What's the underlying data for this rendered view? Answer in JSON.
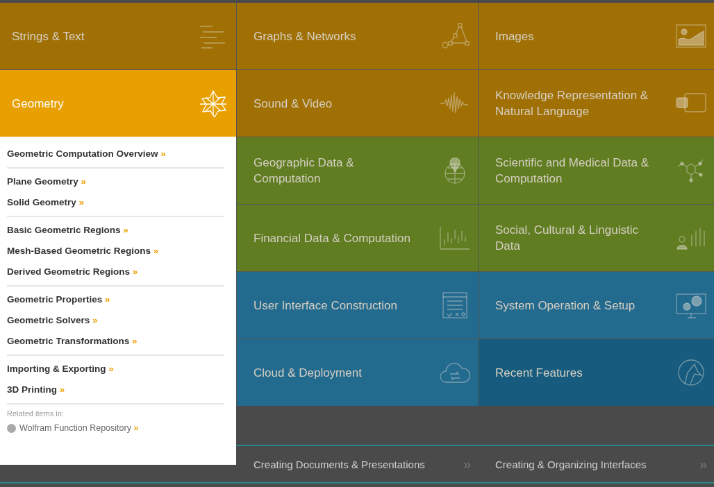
{
  "rows": [
    {
      "tiles": [
        {
          "label": "Strings & Text",
          "color": "#a07005",
          "selected": false
        },
        {
          "label": "Graphs & Networks",
          "color": "#a07005",
          "selected": false
        },
        {
          "label": "Images",
          "color": "#a07005",
          "selected": false
        }
      ]
    },
    {
      "tiles": [
        {
          "label": "Geometry",
          "color": "#e8a000",
          "selected": true
        },
        {
          "label": "Sound & Video",
          "color": "#a07005",
          "selected": false
        },
        {
          "label": "Knowledge Representation & Natural Language",
          "color": "#a07005",
          "selected": false
        }
      ]
    },
    {
      "tiles": [
        {
          "label": "Geographic Data & Computation",
          "color": "#607d22",
          "selected": false
        },
        {
          "label": "Scientific and Medical Data & Computation",
          "color": "#607d22",
          "selected": false
        }
      ]
    },
    {
      "tiles": [
        {
          "label": "Financial Data & Computation",
          "color": "#607d22",
          "selected": false
        },
        {
          "label": "Social, Cultural & Linguistic Data",
          "color": "#607d22",
          "selected": false
        }
      ]
    },
    {
      "tiles": [
        {
          "label": "User Interface Construction",
          "color": "#236a8f",
          "selected": false
        },
        {
          "label": "System Operation & Setup",
          "color": "#236a8f",
          "selected": false
        }
      ]
    },
    {
      "tiles": [
        {
          "label": "Cloud & Deployment",
          "color": "#236a8f",
          "selected": false
        },
        {
          "label": "Recent Features",
          "color": "#175c7e",
          "selected": false
        }
      ]
    }
  ],
  "bottom_links": [
    {
      "label": "Creating Documents & Presentations",
      "arrow": "»"
    },
    {
      "label": "Creating & Organizing Interfaces",
      "arrow": "»"
    }
  ],
  "dropdown": {
    "sections": [
      [
        {
          "label": "Geometric Computation Overview",
          "arrow": "»"
        }
      ],
      [
        {
          "label": "Plane Geometry",
          "arrow": "»"
        },
        {
          "label": "Solid Geometry",
          "arrow": "»"
        }
      ],
      [
        {
          "label": "Basic Geometric Regions",
          "arrow": "»"
        },
        {
          "label": "Mesh-Based Geometric Regions",
          "arrow": "»"
        },
        {
          "label": "Derived Geometric Regions",
          "arrow": "»"
        }
      ],
      [
        {
          "label": "Geometric Properties",
          "arrow": "»"
        },
        {
          "label": "Geometric Solvers",
          "arrow": "»"
        },
        {
          "label": "Geometric Transformations",
          "arrow": "»"
        }
      ],
      [
        {
          "label": "Importing & Exporting",
          "arrow": "»"
        },
        {
          "label": "3D Printing",
          "arrow": "»"
        }
      ]
    ],
    "related_heading": "Related items in:",
    "related": [
      {
        "label": "Wolfram Function Repository",
        "arrow": "»"
      }
    ]
  }
}
